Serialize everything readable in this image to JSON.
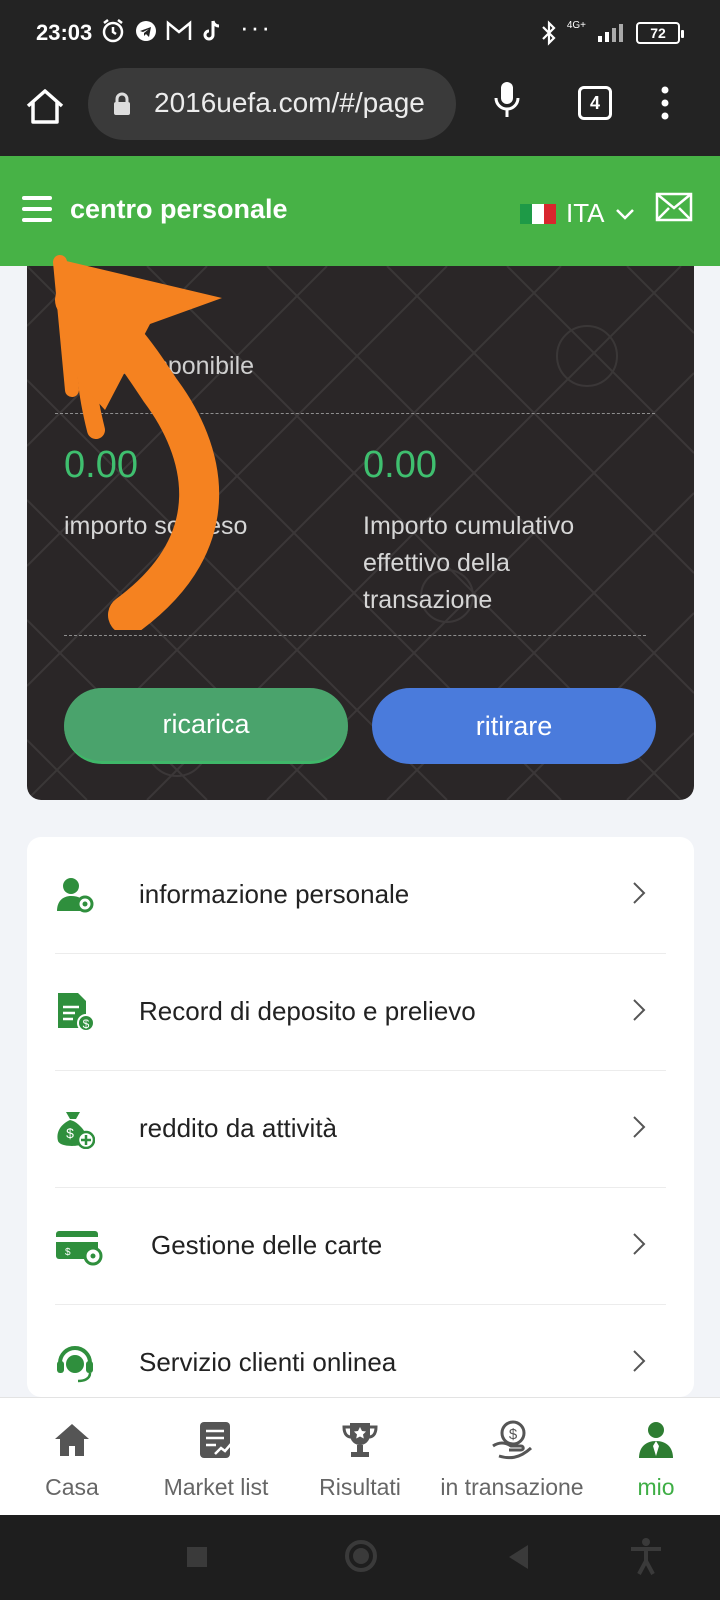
{
  "status_bar": {
    "time": "23:03",
    "battery": "72",
    "network": "4G+"
  },
  "browser": {
    "url": "2016uefa.com/#/page",
    "tab_count": "4"
  },
  "header": {
    "title": "centro personale",
    "language": "ITA"
  },
  "balance": {
    "label": "Saldo disponibile",
    "suspended_value": "0.00",
    "suspended_label": "importo sospeso",
    "cumulative_value": "0.00",
    "cumulative_label": "Importo cumulativo effettivo della transazione"
  },
  "actions": {
    "recharge": "ricarica",
    "withdraw": "ritirare"
  },
  "menu": {
    "items": [
      {
        "label": "informazione personale",
        "icon": "user-settings-icon"
      },
      {
        "label": "Record di deposito e prelievo",
        "icon": "document-money-icon"
      },
      {
        "label": "reddito da attività",
        "icon": "money-bag-icon"
      },
      {
        "label": "Gestione delle carte",
        "icon": "card-settings-icon"
      },
      {
        "label": "Servizio clienti onlinea",
        "icon": "headset-icon"
      }
    ]
  },
  "bottom_nav": {
    "items": [
      {
        "label": "Casa",
        "icon": "home-icon"
      },
      {
        "label": "Market list",
        "icon": "market-list-icon"
      },
      {
        "label": "Risultati",
        "icon": "trophy-icon"
      },
      {
        "label": "in transazione",
        "icon": "hand-money-icon"
      },
      {
        "label": "mio",
        "icon": "user-icon"
      }
    ]
  },
  "colors": {
    "header_green": "#47b246",
    "value_green": "#3fbf6f",
    "withdraw_blue": "#4a7bdc",
    "arrow_orange": "#f58220"
  }
}
